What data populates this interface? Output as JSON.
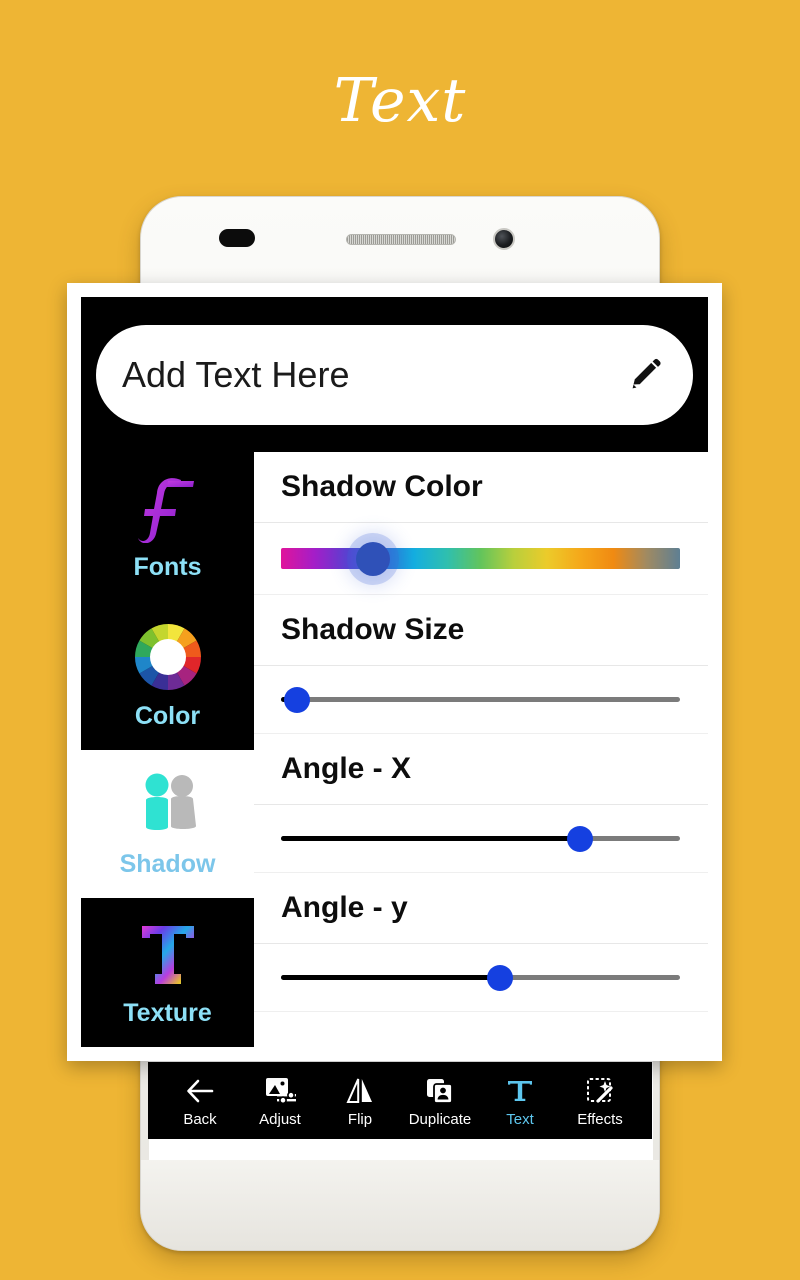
{
  "app": {
    "page_title": "Text",
    "background_color": "#eeb534",
    "accent_color": "#5ec7ef"
  },
  "text_input": {
    "value": "Add Text Here",
    "placeholder": "Add Text Here",
    "edit_icon": "pencil-icon"
  },
  "sidebar": {
    "items": [
      {
        "id": "fonts",
        "label": "Fonts",
        "icon": "script-f-icon",
        "selected": false
      },
      {
        "id": "color",
        "label": "Color",
        "icon": "color-wheel-icon",
        "selected": false
      },
      {
        "id": "shadow",
        "label": "Shadow",
        "icon": "person-shadow-icon",
        "selected": true
      },
      {
        "id": "texture",
        "label": "Texture",
        "icon": "textured-t-icon",
        "selected": false
      }
    ]
  },
  "controls": {
    "groups": [
      {
        "id": "shadow-color",
        "title": "Shadow Color",
        "slider_type": "gradient",
        "value_percent": 23,
        "thumb_color": "#2f51b8",
        "gradient_stops": [
          "#e0149b",
          "#a41ec8",
          "#5b3fd0",
          "#2c6fd6",
          "#14aee0",
          "#2fbfae",
          "#62c45c",
          "#b9cf3c",
          "#eccb2a",
          "#f5a81a",
          "#f08a12",
          "#a08a62",
          "#5e7f93"
        ]
      },
      {
        "id": "shadow-size",
        "title": "Shadow Size",
        "slider_type": "linear",
        "value_percent": 4,
        "thumb_color": "#1540e0",
        "fill_color": "#000000",
        "track_color": "#7b7b7b"
      },
      {
        "id": "angle-x",
        "title": "Angle - X",
        "slider_type": "linear",
        "value_percent": 75,
        "thumb_color": "#1540e0",
        "fill_color": "#000000",
        "track_color": "#7b7b7b"
      },
      {
        "id": "angle-y",
        "title": "Angle - y",
        "slider_type": "linear",
        "value_percent": 55,
        "thumb_color": "#1540e0",
        "fill_color": "#000000",
        "track_color": "#7b7b7b"
      }
    ]
  },
  "bottom_toolbar": {
    "items": [
      {
        "id": "back",
        "label": "Back",
        "icon": "arrow-left-icon",
        "active": false
      },
      {
        "id": "adjust",
        "label": "Adjust",
        "icon": "image-sliders-icon",
        "active": false
      },
      {
        "id": "flip",
        "label": "Flip",
        "icon": "flip-mirror-icon",
        "active": false
      },
      {
        "id": "duplicate",
        "label": "Duplicate",
        "icon": "duplicate-icon",
        "active": false
      },
      {
        "id": "text",
        "label": "Text",
        "icon": "text-t-icon",
        "active": true
      },
      {
        "id": "effects",
        "label": "Effects",
        "icon": "magic-wand-icon",
        "active": false
      }
    ]
  }
}
